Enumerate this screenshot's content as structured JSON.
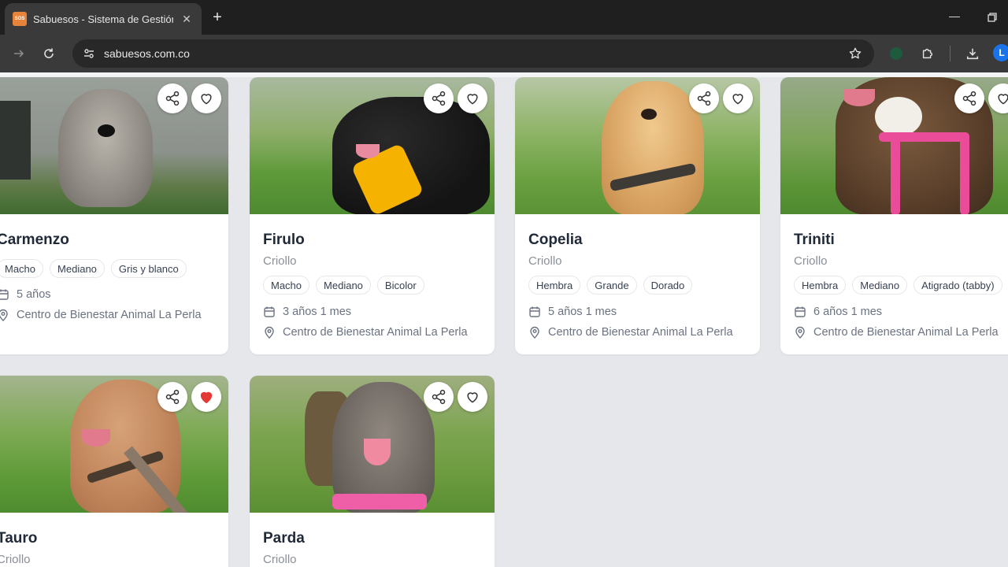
{
  "browser": {
    "tab_title": "Sabuesos - Sistema de Gestión",
    "favicon_text": "SOS",
    "url": "sabuesos.com.co",
    "profile_initial": "L"
  },
  "colors": {
    "favorite_active": "#e53935",
    "card_bg": "#ffffff",
    "page_bg": "#e5e7eb"
  },
  "dogs": [
    {
      "name": "Carmenzo",
      "breed": "",
      "tags": [
        "Macho",
        "Mediano",
        "Gris y blanco"
      ],
      "age": "5 años",
      "location": "Centro de Bienestar Animal La Perla",
      "favorite": false
    },
    {
      "name": "Firulo",
      "breed": "Criollo",
      "tags": [
        "Macho",
        "Mediano",
        "Bicolor"
      ],
      "age": "3 años 1 mes",
      "location": "Centro de Bienestar Animal La Perla",
      "favorite": false
    },
    {
      "name": "Copelia",
      "breed": "Criollo",
      "tags": [
        "Hembra",
        "Grande",
        "Dorado"
      ],
      "age": "5 años 1 mes",
      "location": "Centro de Bienestar Animal La Perla",
      "favorite": false
    },
    {
      "name": "Triniti",
      "breed": "Criollo",
      "tags": [
        "Hembra",
        "Mediano",
        "Atigrado (tabby)"
      ],
      "age": "6 años 1 mes",
      "location": "Centro de Bienestar Animal La Perla",
      "favorite": false
    },
    {
      "name": "Tauro",
      "breed": "Criollo",
      "favorite": true
    },
    {
      "name": "Parda",
      "breed": "Criollo",
      "favorite": false
    }
  ]
}
